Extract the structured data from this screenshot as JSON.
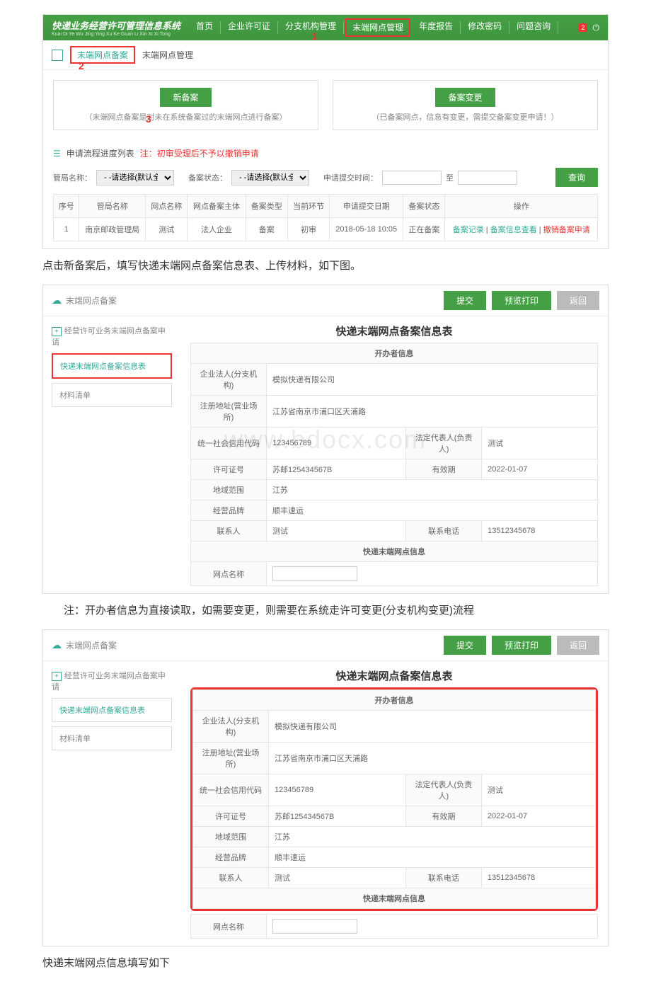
{
  "nav": {
    "title": "快递业务经营许可管理信息系统",
    "sub": "Kuai Di Ye Wu Jing Ying Xu Ke Guan Li Xin Xi Xi Tong",
    "items": [
      "首页",
      "企业许可证",
      "分支机构管理",
      "末端网点管理",
      "年度报告",
      "修改密码",
      "问题咨询"
    ],
    "badge": "2"
  },
  "crumbs": {
    "a": "末端网点备案",
    "b": "末端网点管理"
  },
  "marks": {
    "m1": "1",
    "m2": "2",
    "m3": "3"
  },
  "box1": {
    "btn": "新备案",
    "note": "（末端网点备案是对未在系统备案过的末端网点进行备案）"
  },
  "box2": {
    "btn": "备案变更",
    "note": "（已备案网点，信息有变更，需提交备案变更申请！）"
  },
  "list": {
    "title": "申请流程进度列表",
    "warn": "注：初审受理后不予以撤销申请",
    "f1": "管局名称：",
    "f2": "备案状态：",
    "f3": "申请提交时间：",
    "to": "至",
    "sel": "- -请选择(默认全部)- -",
    "q": "查询"
  },
  "th": [
    "序号",
    "管局名称",
    "网点名称",
    "网点备案主体",
    "备案类型",
    "当前环节",
    "申请提交日期",
    "备案状态",
    "操作"
  ],
  "row": {
    "c0": "1",
    "c1": "南京邮政管理局",
    "c2": "测试",
    "c3": "法人企业",
    "c4": "备案",
    "c5": "初审",
    "c6": "2018-05-18 10:05",
    "c7": "正在备案",
    "a1": "备案记录",
    "a2": "备案信息查看",
    "a3": "撤销备案申请"
  },
  "p1": "点击新备案后，填写快递末端网点备案信息表、上传材料，如下图。",
  "p2": "注：开办者信息为直接读取，如需要变更，则需要在系统走许可变更(分支机构变更)流程",
  "p3": "快递末端网点信息填写如下",
  "form": {
    "crumb": "末端网点备案",
    "submit": "提交",
    "print": "预览打印",
    "back": "返回",
    "sideTitle": "经营许可业务末端网点备案申请",
    "tab1": "快递末端网点备案信息表",
    "tab2": "材料清单",
    "title": "快递末端网点备案信息表",
    "sec1": "开办者信息",
    "sec2": "快递末端网点信息",
    "r": [
      [
        "企业法人(分支机构)",
        "模拟快递有限公司"
      ],
      [
        "注册地址(营业场所)",
        "江苏省南京市浦口区天浦路"
      ],
      [
        "统一社会信用代码",
        "123456789",
        "法定代表人(负责人)",
        "测试"
      ],
      [
        "许可证号",
        "苏邮125434567B",
        "有效期",
        "2022-01-07"
      ],
      [
        "地域范围",
        "江苏"
      ],
      [
        "经营品牌",
        "顺丰速运"
      ],
      [
        "联系人",
        "测试",
        "联系电话",
        "13512345678"
      ]
    ],
    "last": "网点名称"
  }
}
